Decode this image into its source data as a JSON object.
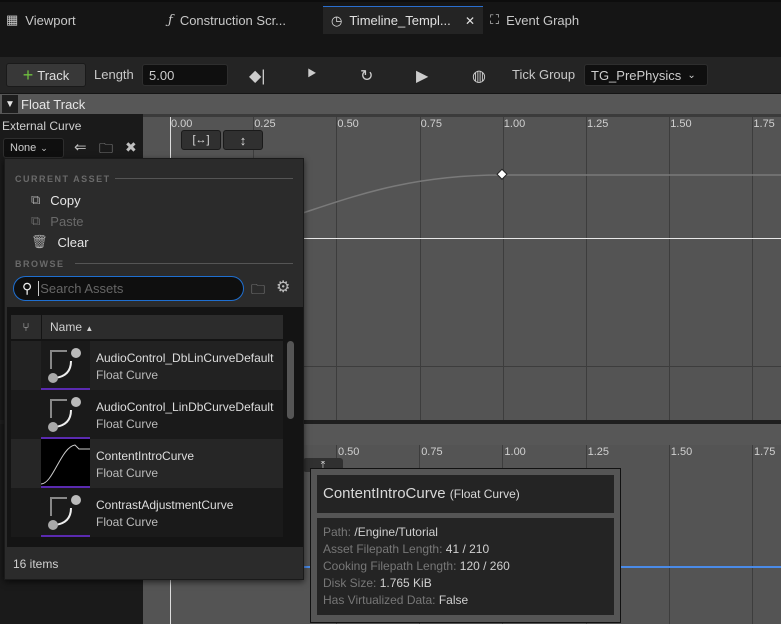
{
  "tabs": [
    {
      "label": "Viewport",
      "icon": "viewport-icon"
    },
    {
      "label": "Construction Scr...",
      "icon": "function-icon"
    },
    {
      "label": "Timeline_Templ...",
      "icon": "clock-icon",
      "active": true
    },
    {
      "label": "Event Graph",
      "icon": "event-graph-icon"
    }
  ],
  "toolbar": {
    "add_track": "Track",
    "length_label": "Length",
    "length_value": "5.00",
    "tick_group_label": "Tick Group",
    "tick_group_value": "TG_PrePhysics"
  },
  "track": {
    "title": "Float Track",
    "external_curve_label": "External Curve",
    "curve_select": "None"
  },
  "ruler": {
    "ticks": [
      "0.00",
      "0.25",
      "0.50",
      "0.75",
      "1.00",
      "1.25",
      "1.50",
      "1.75"
    ],
    "ticks2": [
      "0.50",
      "0.75",
      "1.00",
      "1.25",
      "1.50",
      "1.75"
    ]
  },
  "popup": {
    "current_asset": "CURRENT ASSET",
    "copy": "Copy",
    "paste": "Paste",
    "clear": "Clear",
    "browse": "BROWSE",
    "search_placeholder": "Search Assets",
    "column_name": "Name",
    "items": [
      {
        "name": "AudioControl_DbLinCurveDefault",
        "type": "Float Curve"
      },
      {
        "name": "AudioControl_LinDbCurveDefault",
        "type": "Float Curve"
      },
      {
        "name": "ContentIntroCurve",
        "type": "Float Curve"
      },
      {
        "name": "ContrastAdjustmentCurve",
        "type": "Float Curve"
      }
    ],
    "count": "16 items"
  },
  "tooltip": {
    "title": "ContentIntroCurve",
    "type": "(Float Curve)",
    "rows": [
      {
        "label": "Path:",
        "value": "/Engine/Tutorial"
      },
      {
        "label": "Asset Filepath Length:",
        "value": "41 / 210"
      },
      {
        "label": "Cooking Filepath Length:",
        "value": "120 / 260"
      },
      {
        "label": "Disk Size:",
        "value": "1.765 KiB"
      },
      {
        "label": "Has Virtualized Data:",
        "value": "False"
      }
    ]
  },
  "colors": {
    "accent": "#2a6fcf",
    "curve_thumb_border": "#5a2ab0",
    "add_green": "#6fbf3f",
    "blue_line": "#4a8be8"
  }
}
